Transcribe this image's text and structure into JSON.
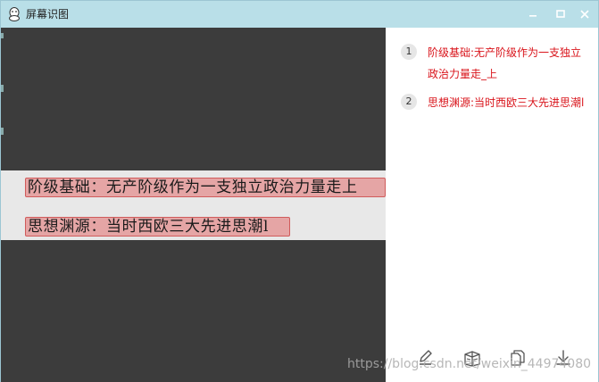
{
  "window": {
    "title": "屏幕识图",
    "title_icon": "app-logo-icon",
    "buttons": [
      "minimize-icon",
      "maximize-icon",
      "close-icon"
    ]
  },
  "image_preview": {
    "lines": [
      "阶级基础：无产阶级作为一支独立政治力量走上",
      "思想渊源：当时西欧三大先进思潮l"
    ]
  },
  "results": [
    {
      "index": "1",
      "text": "阶级基础:无产阶级作为一支独立政治力量走_上"
    },
    {
      "index": "2",
      "text": "思想渊源:当时西欧三大先进思潮l"
    }
  ],
  "toolbar": {
    "icons": [
      "edit-icon",
      "translate-icon",
      "copy-icon",
      "download-icon"
    ]
  },
  "watermark": "https://blog.csdn.net/weixin_44974080",
  "colors": {
    "titlebar": "#b9dfe8",
    "preview_background": "#3c3c3c",
    "result_text": "#d9141b",
    "highlight": "#e26e6e"
  }
}
